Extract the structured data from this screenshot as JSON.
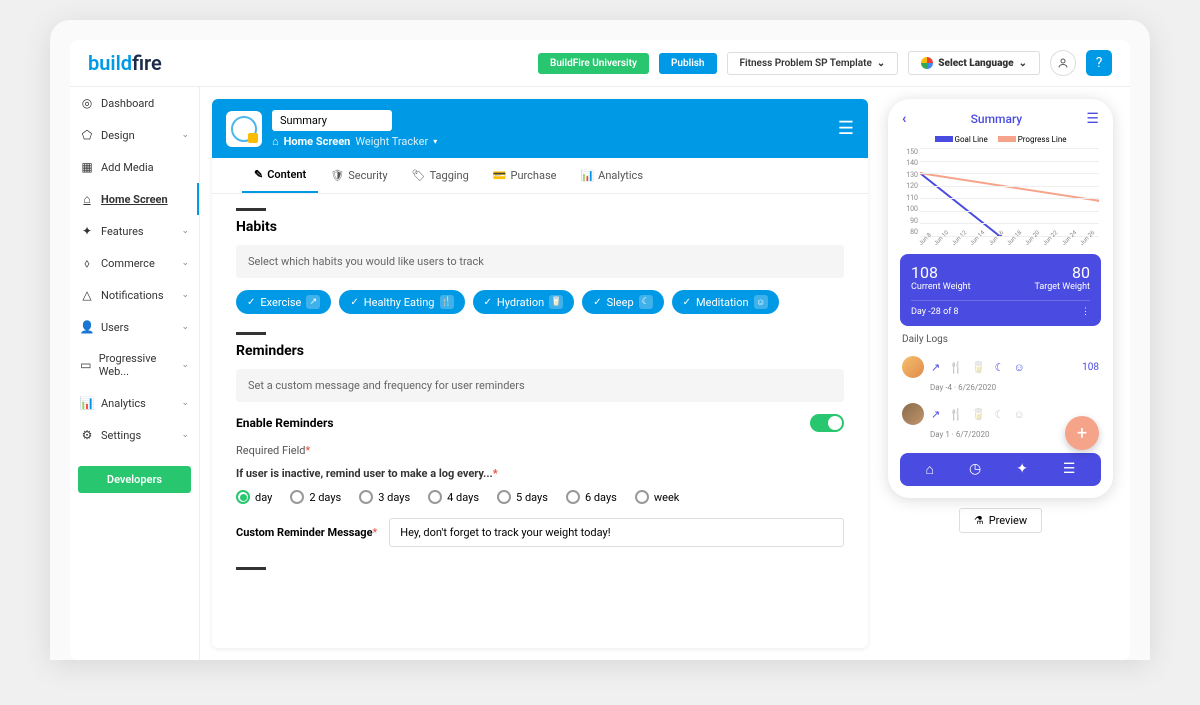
{
  "header": {
    "logo_part1": "build",
    "logo_part2": "fire",
    "university_btn": "BuildFire University",
    "publish_btn": "Publish",
    "template_name": "Fitness Problem SP Template",
    "lang_btn": "Select Language",
    "help_label": "?"
  },
  "sidebar": {
    "items": [
      {
        "label": "Dashboard",
        "icon": "◎",
        "expand": false
      },
      {
        "label": "Design",
        "icon": "⬠",
        "expand": true
      },
      {
        "label": "Add Media",
        "icon": "▦",
        "expand": false
      },
      {
        "label": "Home Screen",
        "icon": "⌂",
        "expand": false,
        "active": true
      },
      {
        "label": "Features",
        "icon": "✦",
        "expand": true
      },
      {
        "label": "Commerce",
        "icon": "⬨",
        "expand": true
      },
      {
        "label": "Notifications",
        "icon": "△",
        "expand": true
      },
      {
        "label": "Users",
        "icon": "👤",
        "expand": true
      },
      {
        "label": "Progressive Web...",
        "icon": "▭",
        "expand": true
      },
      {
        "label": "Analytics",
        "icon": "📊",
        "expand": true
      },
      {
        "label": "Settings",
        "icon": "⚙",
        "expand": true
      }
    ],
    "developers_btn": "Developers"
  },
  "editor": {
    "title_input": "Summary",
    "breadcrumb_home": "Home Screen",
    "breadcrumb_page": "Weight Tracker",
    "tabs": [
      "Content",
      "Security",
      "Tagging",
      "Purchase",
      "Analytics"
    ],
    "tab_icons": [
      "✎",
      "🛡",
      "🏷",
      "💳",
      "📊"
    ],
    "active_tab": 0,
    "habits": {
      "title": "Habits",
      "help": "Select which habits you would like users to track",
      "chips": [
        {
          "label": "Exercise",
          "icon": "↗"
        },
        {
          "label": "Healthy Eating",
          "icon": "🍴"
        },
        {
          "label": "Hydration",
          "icon": "🥛"
        },
        {
          "label": "Sleep",
          "icon": "☾"
        },
        {
          "label": "Meditation",
          "icon": "☺"
        }
      ]
    },
    "reminders": {
      "title": "Reminders",
      "help": "Set a custom message and frequency for user reminders",
      "enable_label": "Enable Reminders",
      "required_label": "Required Field",
      "frequency_label": "If user is inactive, remind user to make a log every...",
      "options": [
        "day",
        "2 days",
        "3 days",
        "4 days",
        "5 days",
        "6 days",
        "week"
      ],
      "selected": 0,
      "msg_label": "Custom Reminder Message",
      "msg_value": "Hey, don't forget to track your weight today!"
    }
  },
  "phone": {
    "title": "Summary",
    "legend1": "Goal Line",
    "legend2": "Progress Line",
    "current_weight": "108",
    "current_label": "Current Weight",
    "target_weight": "80",
    "target_label": "Target Weight",
    "day_text": "Day -28 of 8",
    "daily_logs": "Daily Logs",
    "log1_day": "Day -4  ·  6/26/2020",
    "log1_val": "108",
    "log2_day": "Day 1  ·  6/7/2020",
    "preview_btn": "Preview"
  },
  "chart_data": {
    "type": "line",
    "ylim": [
      80,
      150
    ],
    "yticks": [
      150,
      140,
      130,
      120,
      110,
      100,
      90,
      80
    ],
    "x_categories": [
      "Jun 8",
      "Jun 10",
      "Jun 12",
      "Jun 14",
      "Jun 16",
      "Jun 18",
      "Jun 20",
      "Jun 22",
      "Jun 24",
      "Jun 26"
    ],
    "series": [
      {
        "name": "Goal Line",
        "color": "#4a4be0",
        "points": [
          [
            0,
            130
          ],
          [
            4,
            80
          ]
        ]
      },
      {
        "name": "Progress Line",
        "color": "#f5a48a",
        "points": [
          [
            0,
            130
          ],
          [
            9,
            108
          ]
        ]
      }
    ]
  }
}
